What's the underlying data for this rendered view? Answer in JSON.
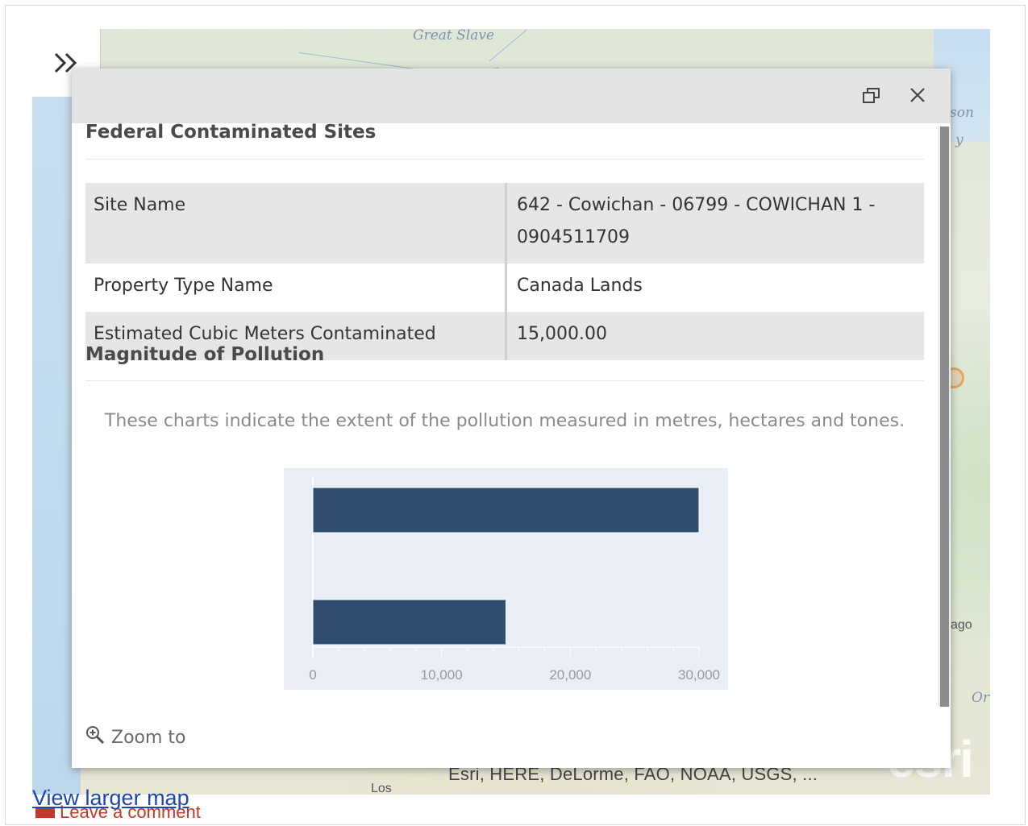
{
  "map": {
    "labels": {
      "great_slave_lake": "Great Slave",
      "hudson": "son",
      "hudson_bay": "y",
      "chicago": "ago",
      "los": "Los",
      "ontario": "Or"
    },
    "attribution": "Esri, HERE, DeLorme, FAO, NOAA, USGS, ...",
    "logo": "esri",
    "expand_icon": "double-chevron-right-icon"
  },
  "popup": {
    "restore_icon": "restore-window-icon",
    "close_icon": "close-icon",
    "title": "Federal Contaminated Sites",
    "fields": [
      {
        "key": "Site Name",
        "value": "642 - Cowichan - 06799 - COWICHAN 1 - 0904511709"
      },
      {
        "key": "Property Type Name",
        "value": "Canada Lands"
      },
      {
        "key": "Estimated Cubic Meters Contaminated",
        "value": "15,000.00"
      }
    ],
    "section_title": "Magnitude of Pollution",
    "description": "These charts indicate the extent of the pollution measured in metres, hectares and tones.",
    "zoom_label": "Zoom to",
    "zoom_icon": "zoom-in-icon"
  },
  "chart_data": {
    "type": "bar",
    "orientation": "horizontal",
    "categories": [
      "",
      ""
    ],
    "values": [
      30000,
      15000
    ],
    "xlim": [
      0,
      30000
    ],
    "xticks": [
      "0",
      "10,000",
      "20,000",
      "30,000"
    ],
    "bar_color": "#2e4d6f",
    "background": "#e9eef6"
  },
  "footer": {
    "view_larger_map": "View larger map",
    "leave_comment": "Leave a comment"
  }
}
